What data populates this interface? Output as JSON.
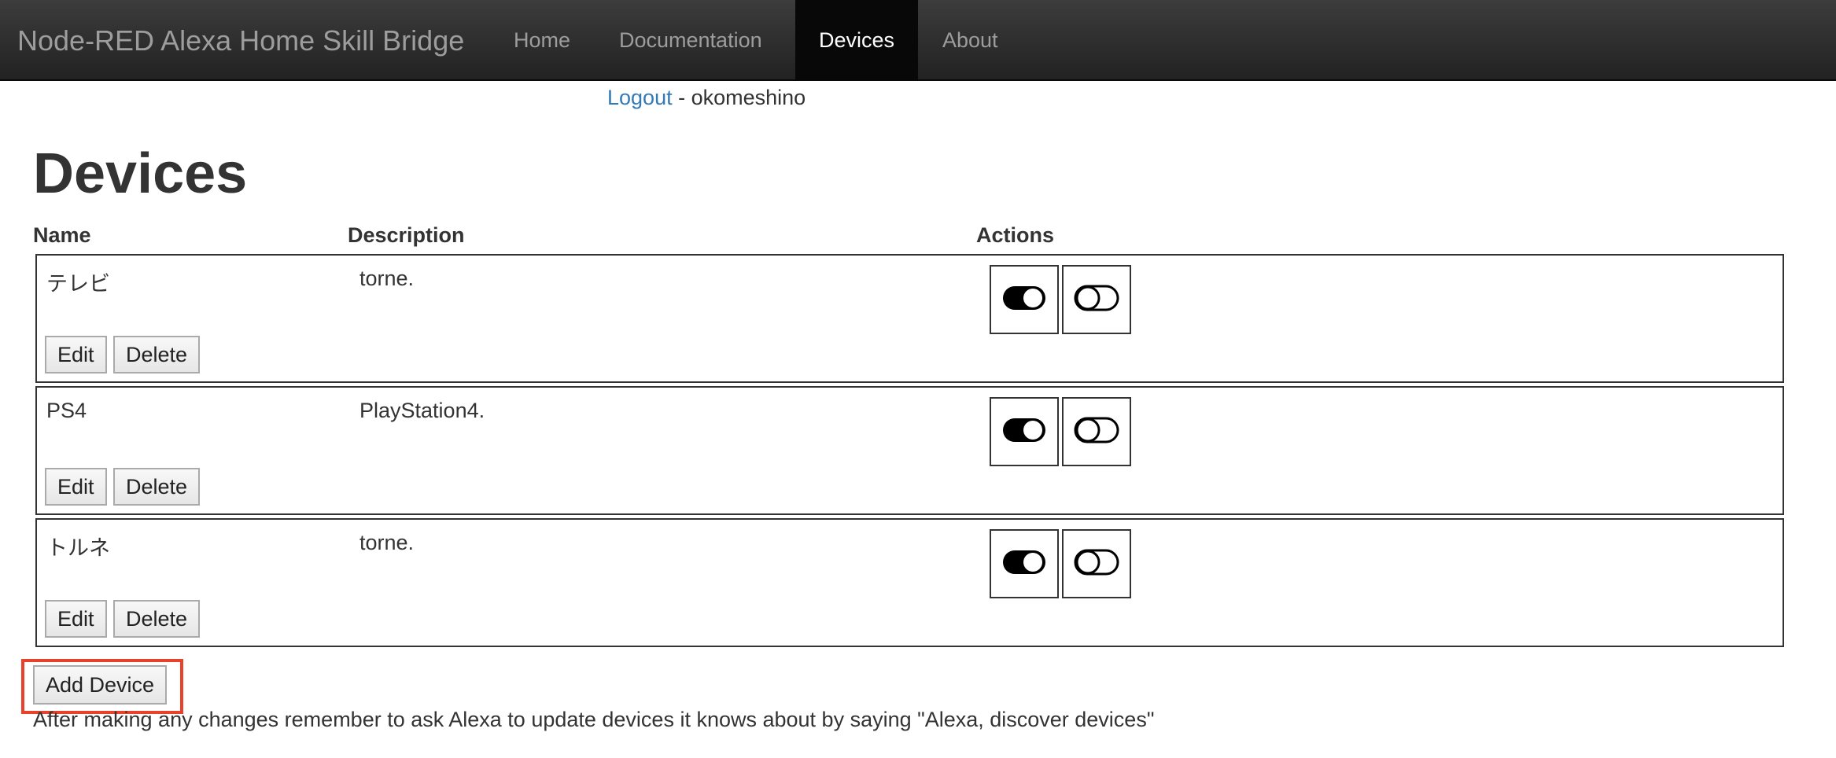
{
  "navbar": {
    "brand": "Node-RED Alexa Home Skill Bridge",
    "items": [
      {
        "label": "Home"
      },
      {
        "label": "Documentation"
      },
      {
        "label": "Devices",
        "active": true
      },
      {
        "label": "About"
      }
    ]
  },
  "user": {
    "logout": "Logout",
    "separator": " - ",
    "username": "okomeshino"
  },
  "page": {
    "title": "Devices"
  },
  "table": {
    "headers": {
      "name": "Name",
      "description": "Description",
      "actions": "Actions"
    },
    "rows": [
      {
        "name": "テレビ",
        "description": "torne."
      },
      {
        "name": "PS4",
        "description": "PlayStation4."
      },
      {
        "name": "トルネ",
        "description": "torne."
      }
    ],
    "edit_label": "Edit",
    "delete_label": "Delete"
  },
  "add_device_label": "Add Device",
  "footer_note": "After making any changes remember to ask Alexa to update devices it knows about by saying \"Alexa, discover devices\"",
  "colors": {
    "highlight": "#e8412c",
    "link": "#337ab7"
  }
}
